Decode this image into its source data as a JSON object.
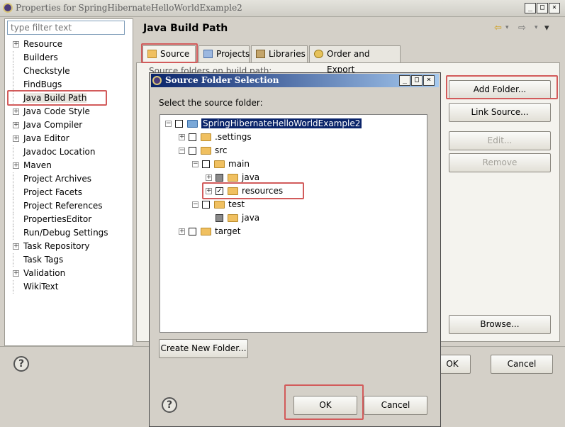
{
  "window": {
    "title": "Properties for SpringHibernateHelloWorldExample2",
    "controls": [
      "_",
      "□",
      "×"
    ]
  },
  "filter": {
    "placeholder": "type filter text"
  },
  "sidebar": {
    "items": [
      {
        "label": "Resource",
        "expandable": true
      },
      {
        "label": "Builders",
        "expandable": false
      },
      {
        "label": "Checkstyle",
        "expandable": false
      },
      {
        "label": "FindBugs",
        "expandable": false
      },
      {
        "label": "Java Build Path",
        "expandable": false,
        "selected": true
      },
      {
        "label": "Java Code Style",
        "expandable": true
      },
      {
        "label": "Java Compiler",
        "expandable": true
      },
      {
        "label": "Java Editor",
        "expandable": true
      },
      {
        "label": "Javadoc Location",
        "expandable": false
      },
      {
        "label": "Maven",
        "expandable": true
      },
      {
        "label": "Project Archives",
        "expandable": false
      },
      {
        "label": "Project Facets",
        "expandable": false
      },
      {
        "label": "Project References",
        "expandable": false
      },
      {
        "label": "PropertiesEditor",
        "expandable": false
      },
      {
        "label": "Run/Debug Settings",
        "expandable": false
      },
      {
        "label": "Task Repository",
        "expandable": true
      },
      {
        "label": "Task Tags",
        "expandable": false
      },
      {
        "label": "Validation",
        "expandable": true
      },
      {
        "label": "WikiText",
        "expandable": false
      }
    ]
  },
  "main": {
    "title": "Java Build Path",
    "nav": {
      "back": "⇦",
      "forward": "⇨",
      "menu": "▾"
    },
    "tabs": [
      {
        "label": "Source",
        "active": true
      },
      {
        "label": "Projects"
      },
      {
        "label": "Libraries"
      },
      {
        "label": "Order and Export"
      }
    ],
    "source_caption": "Source folders on build path:",
    "buttons": {
      "add_folder": "Add Folder...",
      "link_source": "Link Source...",
      "edit": "Edit...",
      "remove": "Remove",
      "browse": "Browse..."
    }
  },
  "bottom": {
    "ok": "OK",
    "cancel": "Cancel"
  },
  "dialog": {
    "title": "Source Folder Selection",
    "prompt": "Select the source folder:",
    "tree": [
      {
        "label": "SpringHibernateHelloWorldExample2",
        "level": 0,
        "expander": "⊟",
        "checked": false,
        "project": true,
        "selected": true
      },
      {
        "label": ".settings",
        "level": 1,
        "expander": "⊞",
        "checked": false
      },
      {
        "label": "src",
        "level": 1,
        "expander": "⊟",
        "checked": false
      },
      {
        "label": "main",
        "level": 2,
        "expander": "⊟",
        "checked": false
      },
      {
        "label": "java",
        "level": 3,
        "expander": "⊞",
        "checked": "gray"
      },
      {
        "label": "resources",
        "level": 3,
        "expander": "⊞",
        "checked": true
      },
      {
        "label": "test",
        "level": 2,
        "expander": "⊟",
        "checked": false
      },
      {
        "label": "java",
        "level": 3,
        "expander": "",
        "checked": "gray"
      },
      {
        "label": "target",
        "level": 1,
        "expander": "⊞",
        "checked": false
      }
    ],
    "create_folder": "Create New Folder...",
    "ok": "OK",
    "cancel": "Cancel"
  },
  "colors": {
    "highlight_box": "#d25b5b",
    "title_gradient_start": "#0a246a",
    "selection": "#0a246a"
  }
}
